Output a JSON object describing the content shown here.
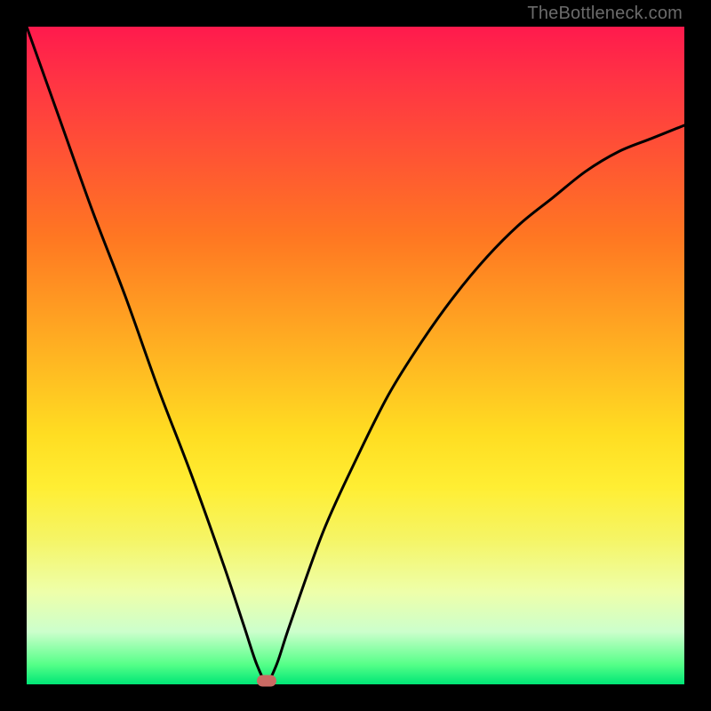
{
  "watermark": "TheBottleneck.com",
  "chart_data": {
    "type": "line",
    "title": "",
    "xlabel": "",
    "ylabel": "",
    "xlim": [
      0,
      100
    ],
    "ylim": [
      0,
      100
    ],
    "background": {
      "gradient": "vertical",
      "stops": [
        {
          "pos": 0,
          "color": "#ff1a4d"
        },
        {
          "pos": 50,
          "color": "#ffcc22"
        },
        {
          "pos": 80,
          "color": "#f0f590"
        },
        {
          "pos": 100,
          "color": "#00e676"
        }
      ]
    },
    "series": [
      {
        "name": "bottleneck-curve",
        "x": [
          0,
          5,
          10,
          15,
          20,
          25,
          30,
          33,
          35,
          36.5,
          38,
          40,
          45,
          50,
          55,
          60,
          65,
          70,
          75,
          80,
          85,
          90,
          95,
          100
        ],
        "y": [
          100,
          86,
          72,
          59,
          45,
          32,
          18,
          9,
          3,
          0.5,
          3,
          9,
          23,
          34,
          44,
          52,
          59,
          65,
          70,
          74,
          78,
          81,
          83,
          85
        ]
      }
    ],
    "annotations": [
      {
        "name": "minimum-marker",
        "x": 36.5,
        "y": 0.5,
        "color": "#c96a63"
      }
    ]
  }
}
